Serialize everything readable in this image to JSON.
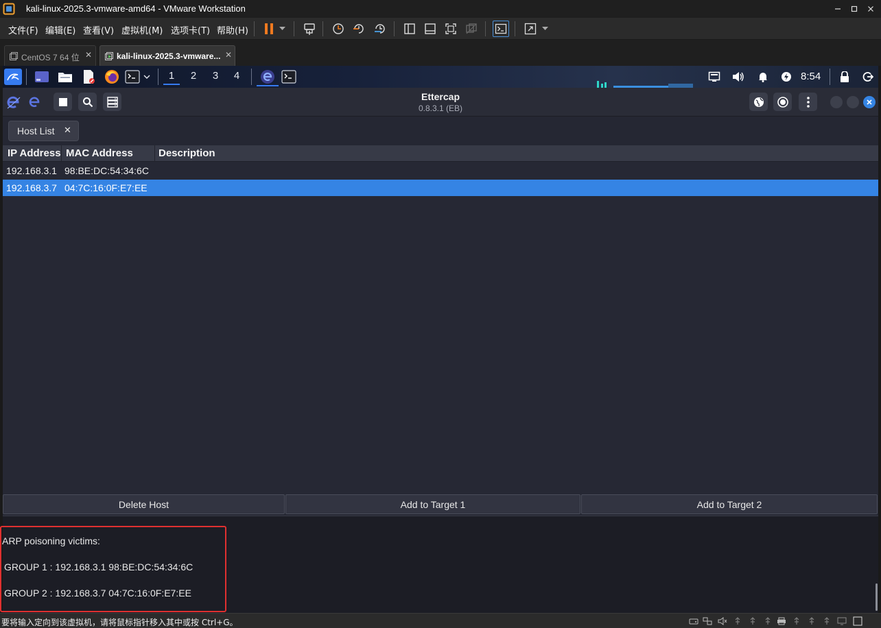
{
  "window": {
    "title": "kali-linux-2025.3-vmware-amd64 - VMware Workstation"
  },
  "menu": [
    "文件(F)",
    "编辑(E)",
    "查看(V)",
    "虚拟机(M)",
    "选项卡(T)",
    "帮助(H)"
  ],
  "tabs": [
    {
      "label": "CentOS 7 64 位"
    },
    {
      "label": "kali-linux-2025.3-vmware..."
    }
  ],
  "kali_panel": {
    "workspaces": [
      "1",
      "2",
      "3",
      "4"
    ],
    "active_workspace": "1",
    "clock": "8:54"
  },
  "ettercap": {
    "title": "Ettercap",
    "version": "0.8.3.1 (EB)"
  },
  "host_list": {
    "tab_label": "Host List",
    "columns": [
      "IP Address",
      "MAC Address",
      "Description"
    ],
    "rows": [
      {
        "ip": "192.168.3.1",
        "mac": "98:BE:DC:54:34:6C",
        "description": ""
      },
      {
        "ip": "192.168.3.7",
        "mac": "04:7C:16:0F:E7:EE",
        "description": ""
      }
    ],
    "selected_row_index": 1
  },
  "buttons": {
    "delete_host": "Delete Host",
    "add_target_1": "Add to Target 1",
    "add_target_2": "Add to Target 2"
  },
  "log": {
    "lines": [
      "ARP poisoning victims:",
      "GROUP 1 : 192.168.3.1 98:BE:DC:54:34:6C",
      "GROUP 2 : 192.168.3.7 04:7C:16:0F:E7:EE"
    ]
  },
  "status_bar": {
    "message": "要将输入定向到该虚拟机，请将鼠标指针移入其中或按 Ctrl+G。"
  },
  "colors": {
    "selection": "#3584e4",
    "highlight_box": "#e03030",
    "pause_icon": "#f07a20",
    "kali_blue": "#367bf0"
  }
}
